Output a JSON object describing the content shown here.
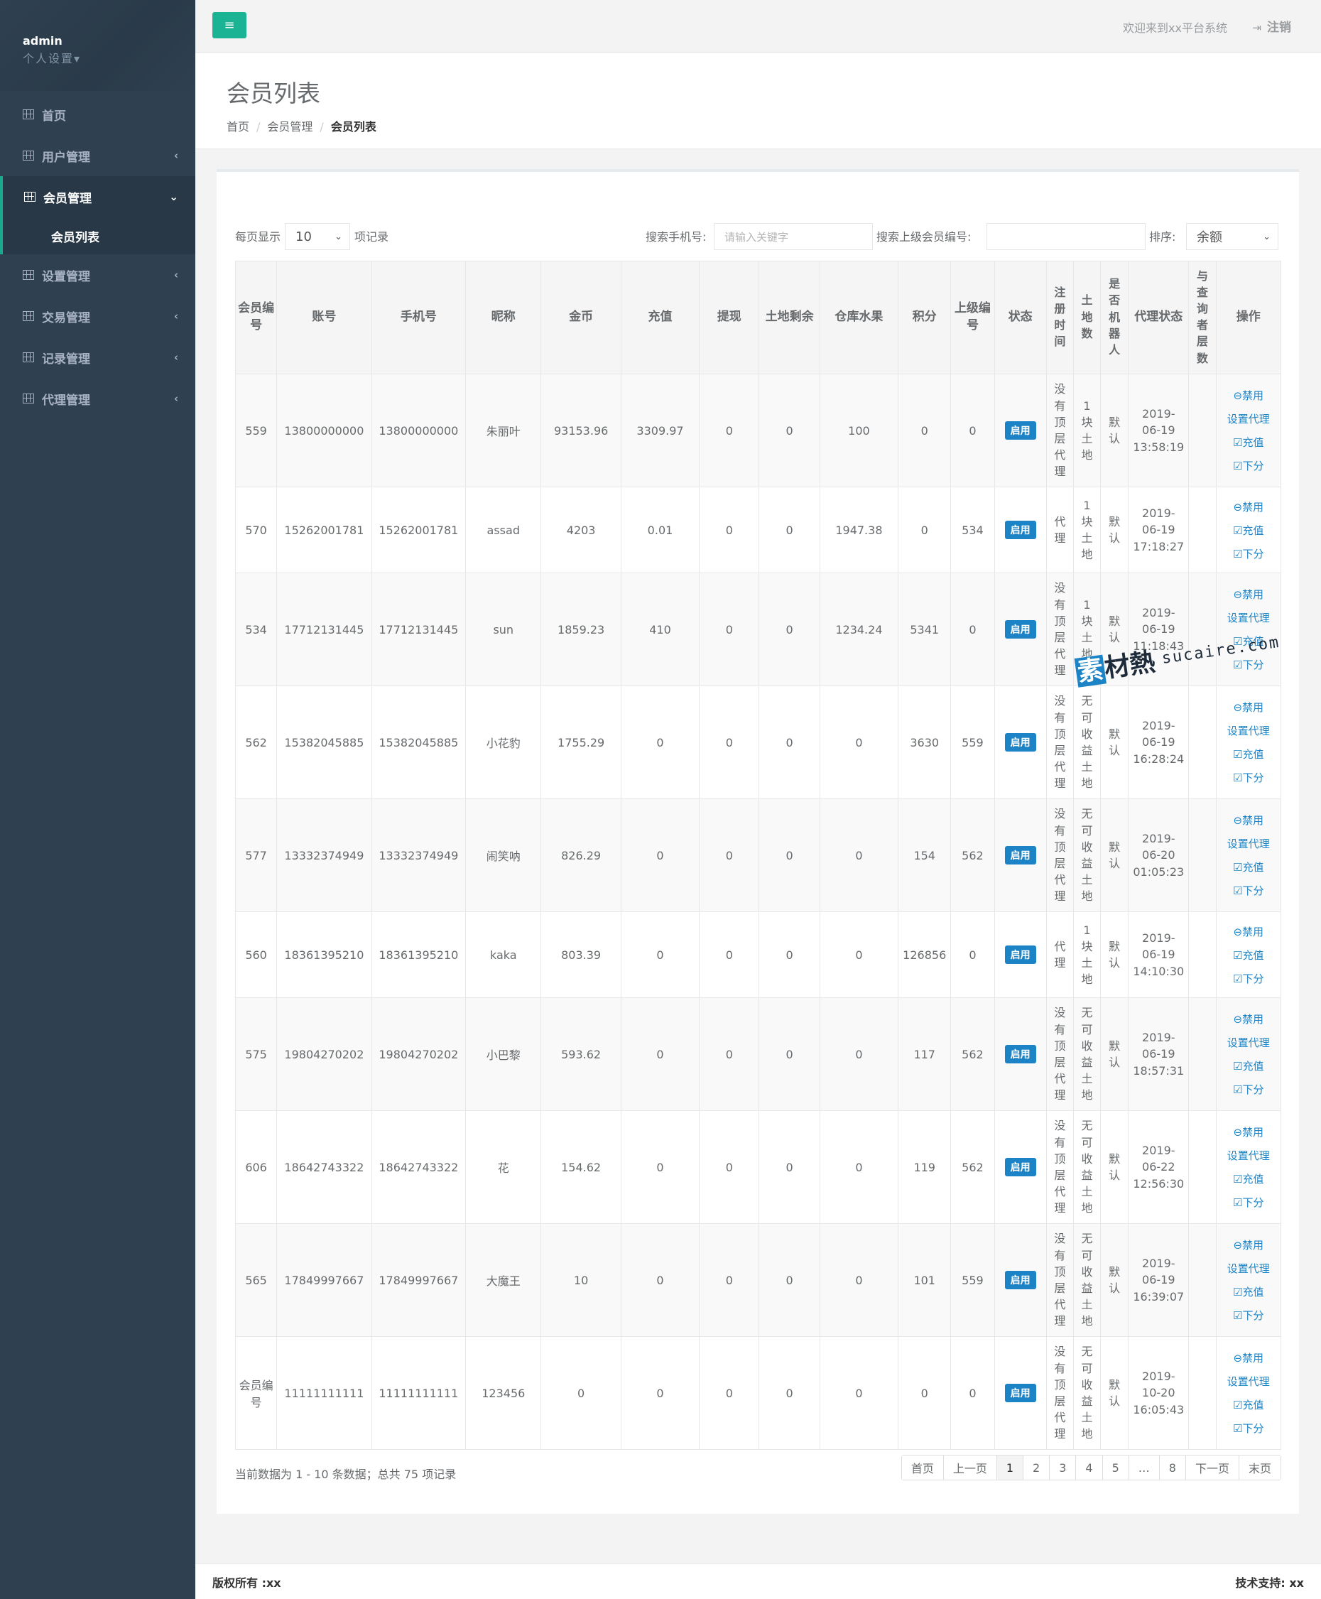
{
  "user": {
    "name": "admin",
    "settings": "个人设置▾"
  },
  "nav": [
    {
      "label": "首页",
      "arrow": ""
    },
    {
      "label": "用户管理",
      "arrow": "‹"
    },
    {
      "label": "会员管理",
      "arrow": "⌄"
    },
    {
      "label": "会员列表",
      "arrow": ""
    },
    {
      "label": "设置管理",
      "arrow": "‹"
    },
    {
      "label": "交易管理",
      "arrow": "‹"
    },
    {
      "label": "记录管理",
      "arrow": "‹"
    },
    {
      "label": "代理管理",
      "arrow": "‹"
    }
  ],
  "topbar": {
    "menu_icon": "≡",
    "welcome": "欢迎来到xx平台系统",
    "logout": "注销",
    "logout_icon": "⇥"
  },
  "page": {
    "title": "会员列表",
    "breadcrumb": [
      "首页",
      "会员管理",
      "会员列表"
    ]
  },
  "controls": {
    "per_page_label": "每页显示",
    "per_page_value": "10",
    "per_page_suffix": "项记录",
    "search_phone_label": "搜索手机号:",
    "search_phone_placeholder": "请输入关键字",
    "search_parent_label": "搜索上级会员编号:",
    "search_parent_value": "",
    "sort_label": "排序:",
    "sort_value": "余额"
  },
  "table": {
    "headers": [
      "会员编号",
      "账号",
      "手机号",
      "昵称",
      "金币",
      "充值",
      "提现",
      "土地剩余",
      "仓库水果",
      "积分",
      "上级编号",
      "状态",
      "注册时间",
      "土地数",
      "是否机器人",
      "代理状态",
      "与查询者层数",
      "操作"
    ],
    "rows": [
      {
        "id": "559",
        "account": "13800000000",
        "phone": "13800000000",
        "nick": "朱丽叶",
        "gold": "93153.96",
        "recharge": "3309.97",
        "withdraw": "0",
        "land_left": "0",
        "fruit": "100",
        "points": "0",
        "parent": "0",
        "status": "启用",
        "reg": "没有顶层代理",
        "land": "1块土地",
        "robot": "默认",
        "agent": "2019-06-19 13:58:19",
        "layer": "",
        "ops": [
          "⊖禁用",
          "设置代理",
          "☑充值",
          "☑下分"
        ]
      },
      {
        "id": "570",
        "account": "15262001781",
        "phone": "15262001781",
        "nick": "assad",
        "gold": "4203",
        "recharge": "0.01",
        "withdraw": "0",
        "land_left": "0",
        "fruit": "1947.38",
        "points": "0",
        "parent": "534",
        "status": "启用",
        "reg": "代理",
        "land": "1块土地",
        "robot": "默认",
        "agent": "2019-06-19 17:18:27",
        "layer": "",
        "ops": [
          "⊖禁用",
          "☑充值",
          "☑下分"
        ]
      },
      {
        "id": "534",
        "account": "17712131445",
        "phone": "17712131445",
        "nick": "sun",
        "gold": "1859.23",
        "recharge": "410",
        "withdraw": "0",
        "land_left": "0",
        "fruit": "1234.24",
        "points": "5341",
        "parent": "0",
        "status": "启用",
        "reg": "没有顶层代理",
        "land": "1块土地",
        "robot": "默认",
        "agent": "2019-06-19 11:18:43",
        "layer": "",
        "ops": [
          "⊖禁用",
          "设置代理",
          "☑充值",
          "☑下分"
        ]
      },
      {
        "id": "562",
        "account": "15382045885",
        "phone": "15382045885",
        "nick": "小花豹",
        "gold": "1755.29",
        "recharge": "0",
        "withdraw": "0",
        "land_left": "0",
        "fruit": "0",
        "points": "3630",
        "parent": "559",
        "status": "启用",
        "reg": "没有顶层代理",
        "land": "无可收益土地",
        "robot": "默认",
        "agent": "2019-06-19 16:28:24",
        "layer": "",
        "ops": [
          "⊖禁用",
          "设置代理",
          "☑充值",
          "☑下分"
        ]
      },
      {
        "id": "577",
        "account": "13332374949",
        "phone": "13332374949",
        "nick": "闹笑呐",
        "gold": "826.29",
        "recharge": "0",
        "withdraw": "0",
        "land_left": "0",
        "fruit": "0",
        "points": "154",
        "parent": "562",
        "status": "启用",
        "reg": "没有顶层代理",
        "land": "无可收益土地",
        "robot": "默认",
        "agent": "2019-06-20 01:05:23",
        "layer": "",
        "ops": [
          "⊖禁用",
          "设置代理",
          "☑充值",
          "☑下分"
        ]
      },
      {
        "id": "560",
        "account": "18361395210",
        "phone": "18361395210",
        "nick": "kaka",
        "gold": "803.39",
        "recharge": "0",
        "withdraw": "0",
        "land_left": "0",
        "fruit": "0",
        "points": "126856",
        "parent": "0",
        "status": "启用",
        "reg": "代理",
        "land": "1块土地",
        "robot": "默认",
        "agent": "2019-06-19 14:10:30",
        "layer": "",
        "ops": [
          "⊖禁用",
          "☑充值",
          "☑下分"
        ]
      },
      {
        "id": "575",
        "account": "19804270202",
        "phone": "19804270202",
        "nick": "小巴黎",
        "gold": "593.62",
        "recharge": "0",
        "withdraw": "0",
        "land_left": "0",
        "fruit": "0",
        "points": "117",
        "parent": "562",
        "status": "启用",
        "reg": "没有顶层代理",
        "land": "无可收益土地",
        "robot": "默认",
        "agent": "2019-06-19 18:57:31",
        "layer": "",
        "ops": [
          "⊖禁用",
          "设置代理",
          "☑充值",
          "☑下分"
        ]
      },
      {
        "id": "606",
        "account": "18642743322",
        "phone": "18642743322",
        "nick": "花",
        "gold": "154.62",
        "recharge": "0",
        "withdraw": "0",
        "land_left": "0",
        "fruit": "0",
        "points": "119",
        "parent": "562",
        "status": "启用",
        "reg": "没有顶层代理",
        "land": "无可收益土地",
        "robot": "默认",
        "agent": "2019-06-22 12:56:30",
        "layer": "",
        "ops": [
          "⊖禁用",
          "设置代理",
          "☑充值",
          "☑下分"
        ]
      },
      {
        "id": "565",
        "account": "17849997667",
        "phone": "17849997667",
        "nick": "大魔王",
        "gold": "10",
        "recharge": "0",
        "withdraw": "0",
        "land_left": "0",
        "fruit": "0",
        "points": "101",
        "parent": "559",
        "status": "启用",
        "reg": "没有顶层代理",
        "land": "无可收益土地",
        "robot": "默认",
        "agent": "2019-06-19 16:39:07",
        "layer": "",
        "ops": [
          "⊖禁用",
          "设置代理",
          "☑充值",
          "☑下分"
        ]
      },
      {
        "id": "会员编号",
        "account": "11111111111",
        "phone": "11111111111",
        "nick": "123456",
        "gold": "0",
        "recharge": "0",
        "withdraw": "0",
        "land_left": "0",
        "fruit": "0",
        "points": "0",
        "parent": "0",
        "status": "启用",
        "reg": "没有顶层代理",
        "land": "无可收益土地",
        "robot": "默认",
        "agent": "2019-10-20 16:05:43",
        "layer": "",
        "ops": [
          "⊖禁用",
          "设置代理",
          "☑充值",
          "☑下分"
        ]
      }
    ]
  },
  "pagination": {
    "info": "当前数据为 1 - 10 条数据；总共 75 项记录",
    "pages": [
      "首页",
      "上一页",
      "1",
      "2",
      "3",
      "4",
      "5",
      "…",
      "8",
      "下一页",
      "末页"
    ],
    "active": "1"
  },
  "footer": {
    "left": "版权所有 :xx",
    "right": "技术支持: xx"
  },
  "watermark": {
    "logo_b": "素",
    "logo": "材熱",
    "url": "sucaire.com"
  },
  "colors": {
    "sidebar": "#2f4050",
    "accent": "#1ab394",
    "badge": "#1c84c6"
  }
}
